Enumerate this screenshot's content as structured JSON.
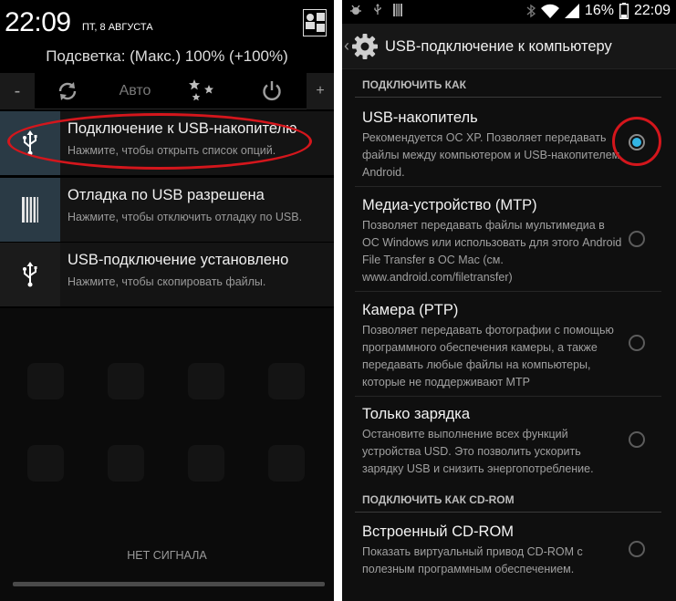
{
  "left": {
    "status": {
      "time": "22:09",
      "date": "пт, 8 августа"
    },
    "brightness": {
      "text": "Подсветка: (Макс.) 100% (+100%)"
    },
    "quick_settings": {
      "minus": "-",
      "auto": "Авто",
      "plus": "+"
    },
    "notifications": [
      {
        "title": "Подключение к USB-накопителю",
        "subtitle": "Нажмите, чтобы открыть список опций.",
        "icon": "usb-icon"
      },
      {
        "title": "Отладка по USB разрешена",
        "subtitle": "Нажмите, чтобы отключить отладку по USB.",
        "icon": "debug-bars-icon"
      },
      {
        "title": "USB-подключение установлено",
        "subtitle": "Нажмите, чтобы скопировать файлы.",
        "icon": "usb-icon"
      }
    ],
    "no_signal": "Нет сигнала"
  },
  "right": {
    "status": {
      "battery": "16%",
      "time": "22:09"
    },
    "title": "USB-подключение к компьютеру",
    "section1": "Подключить как",
    "options": [
      {
        "title": "USB-накопитель",
        "desc": "Рекомендуется ОС XP. Позволяет передавать файлы между компьютером и USB-накопителем Android.",
        "selected": true
      },
      {
        "title": "Медиа-устройство (MTP)",
        "desc": "Позволяет передавать файлы мультимедиа в ОС Windows или использовать для этого Android File Transfer в ОС Mac (см. www.android.com/filetransfer)",
        "selected": false
      },
      {
        "title": "Камера (PTP)",
        "desc": "Позволяет передавать фотографии с помощью программного обеспечения камеры, а также передавать любые файлы на компьютеры, которые не поддерживают MTP",
        "selected": false
      },
      {
        "title": "Только зарядка",
        "desc": "Остановите выполнение всех функций устройства USD. Это позволить ускорить зарядку USB и снизить энергопотребление.",
        "selected": false
      }
    ],
    "section2": "Подключить как CD-ROM",
    "cdrom": {
      "title": "Встроенный CD-ROM",
      "desc": "Показать виртуальный привод CD-ROM с полезным программным обеспечением.",
      "selected": false
    }
  },
  "colors": {
    "accent": "#33b5e5",
    "highlight": "#d4161c",
    "background": "#000000"
  }
}
